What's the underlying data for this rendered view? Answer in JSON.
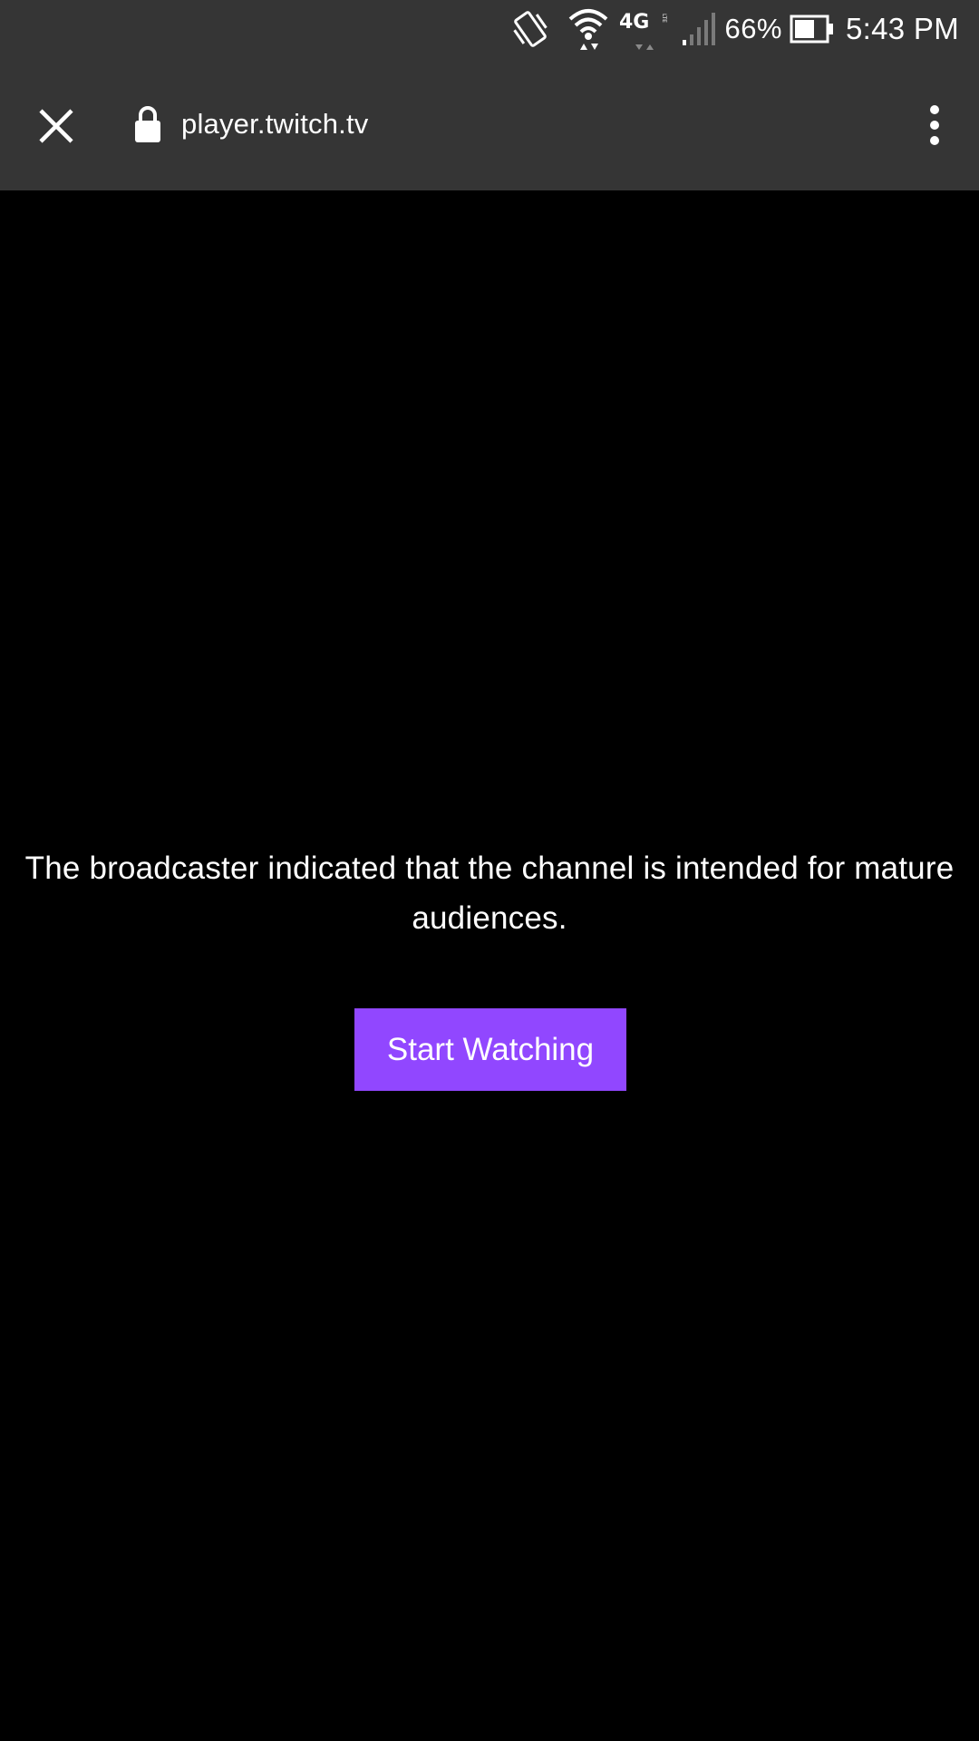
{
  "status_bar": {
    "battery_percent": "66%",
    "time": "5:43 PM",
    "icons": [
      "vibrate-icon",
      "wifi-icon",
      "lte-icon",
      "signal-icon",
      "battery-icon"
    ],
    "network_label": "4G",
    "battery_level": 0.66
  },
  "toolbar": {
    "close_icon": "close-icon",
    "lock_icon": "lock-icon",
    "url": "player.twitch.tv",
    "menu_icon": "more-vert-icon"
  },
  "player": {
    "message": "The broadcaster indicated that the channel is intended for mature audiences.",
    "start_button_label": "Start Watching"
  },
  "colors": {
    "toolbar_bg": "#353535",
    "page_bg": "#000000",
    "accent": "#9147ff",
    "text": "#ffffff"
  }
}
